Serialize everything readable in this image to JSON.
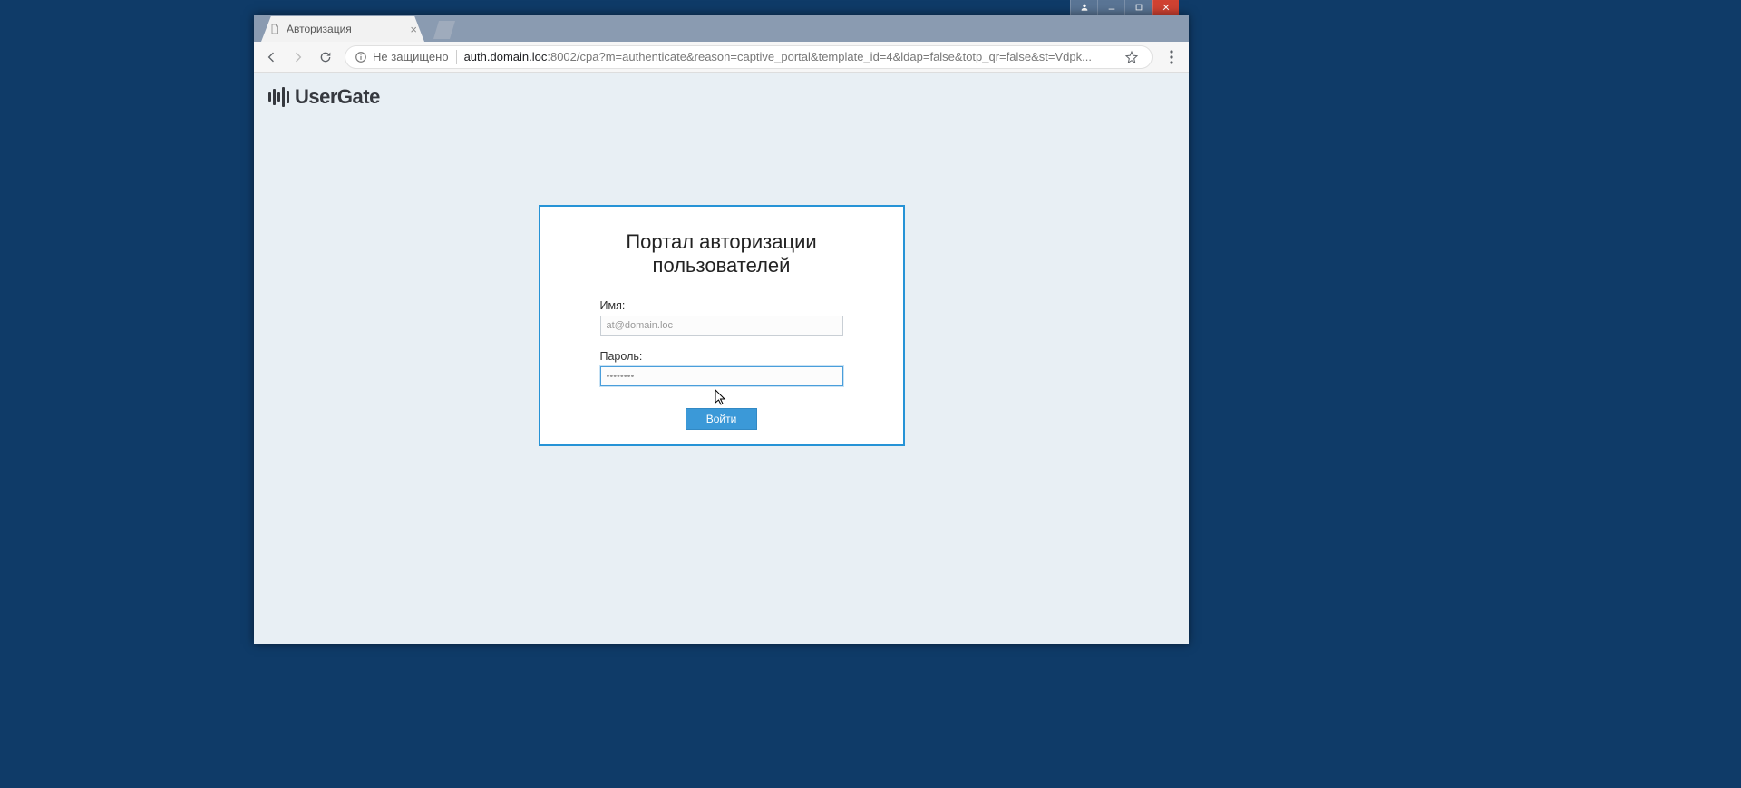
{
  "window": {
    "controls": {
      "user_glyph": "👤",
      "min_glyph": "–",
      "max_glyph": "□",
      "close_glyph": "✕"
    }
  },
  "browser": {
    "tab": {
      "title": "Авторизация"
    },
    "address": {
      "security_text": "Не защищено",
      "domain": "auth.domain.loc",
      "port": ":8002",
      "path": "/cpa?m=authenticate&reason=captive_portal&template_id=4&ldap=false&totp_qr=false&st=Vdpk..."
    }
  },
  "page": {
    "logo_text": "UserGate",
    "auth": {
      "title": "Портал авторизации пользователей",
      "username_label": "Имя:",
      "username_value": "at@domain.loc",
      "password_label": "Пароль:",
      "password_value": "••••••••",
      "submit_label": "Войти"
    }
  }
}
